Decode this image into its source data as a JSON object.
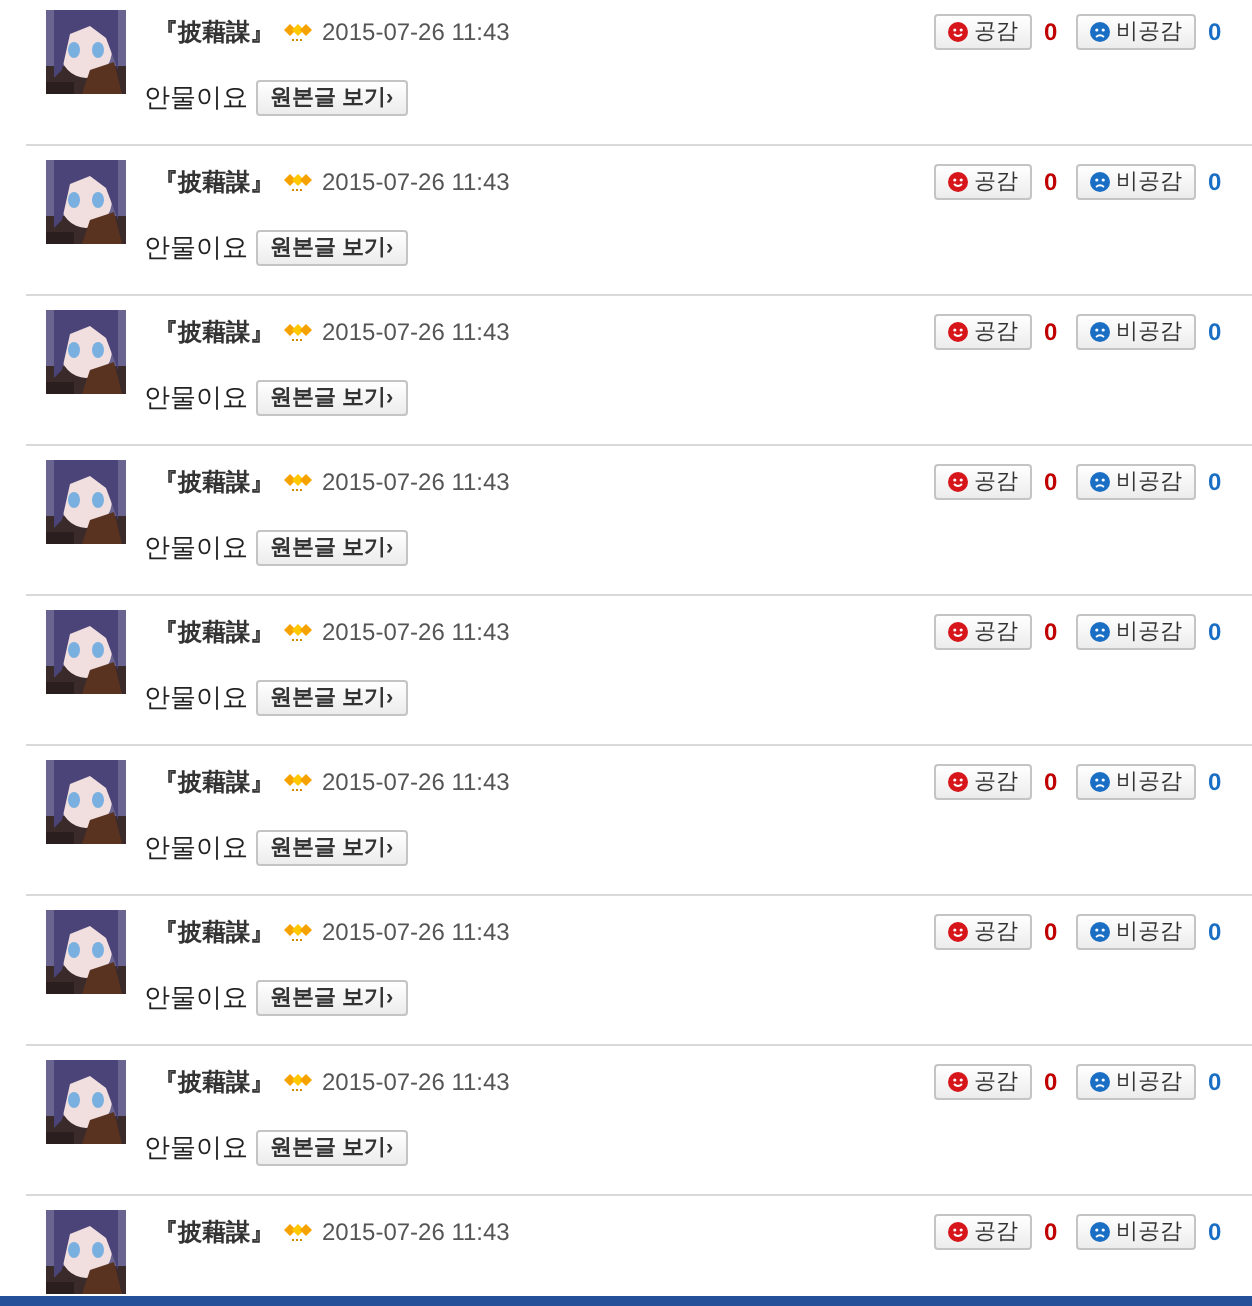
{
  "comments": [
    {
      "author": "『披藉謀』",
      "date": "2015-07-26 11:43",
      "text": "안물이요",
      "original_button": "원본글 보기›",
      "like_label": "공감",
      "like_count": "0",
      "dislike_label": "비공감",
      "dislike_count": "0"
    },
    {
      "author": "『披藉謀』",
      "date": "2015-07-26 11:43",
      "text": "안물이요",
      "original_button": "원본글 보기›",
      "like_label": "공감",
      "like_count": "0",
      "dislike_label": "비공감",
      "dislike_count": "0"
    },
    {
      "author": "『披藉謀』",
      "date": "2015-07-26 11:43",
      "text": "안물이요",
      "original_button": "원본글 보기›",
      "like_label": "공감",
      "like_count": "0",
      "dislike_label": "비공감",
      "dislike_count": "0"
    },
    {
      "author": "『披藉謀』",
      "date": "2015-07-26 11:43",
      "text": "안물이요",
      "original_button": "원본글 보기›",
      "like_label": "공감",
      "like_count": "0",
      "dislike_label": "비공감",
      "dislike_count": "0"
    },
    {
      "author": "『披藉謀』",
      "date": "2015-07-26 11:43",
      "text": "안물이요",
      "original_button": "원본글 보기›",
      "like_label": "공감",
      "like_count": "0",
      "dislike_label": "비공감",
      "dislike_count": "0"
    },
    {
      "author": "『披藉謀』",
      "date": "2015-07-26 11:43",
      "text": "안물이요",
      "original_button": "원본글 보기›",
      "like_label": "공감",
      "like_count": "0",
      "dislike_label": "비공감",
      "dislike_count": "0"
    },
    {
      "author": "『披藉謀』",
      "date": "2015-07-26 11:43",
      "text": "안물이요",
      "original_button": "원본글 보기›",
      "like_label": "공감",
      "like_count": "0",
      "dislike_label": "비공감",
      "dislike_count": "0"
    },
    {
      "author": "『披藉謀』",
      "date": "2015-07-26 11:43",
      "text": "안물이요",
      "original_button": "원본글 보기›",
      "like_label": "공감",
      "like_count": "0",
      "dislike_label": "비공감",
      "dislike_count": "0"
    },
    {
      "author": "『披藉謀』",
      "date": "2015-07-26 11:43",
      "like_label": "공감",
      "like_count": "0",
      "dislike_label": "비공감",
      "dislike_count": "0"
    }
  ]
}
